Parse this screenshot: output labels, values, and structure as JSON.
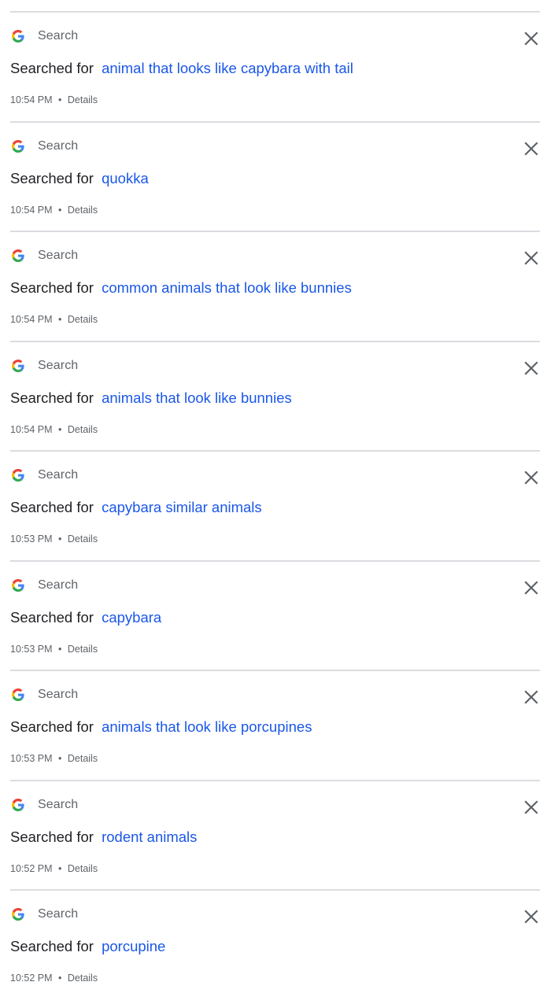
{
  "activity": {
    "items": [
      {
        "product": "Search",
        "prefix": "Searched for",
        "query": "animal that looks like capybara with tail",
        "time": "10:54 PM",
        "separator": "•",
        "details": "Details"
      },
      {
        "product": "Search",
        "prefix": "Searched for",
        "query": "quokka",
        "time": "10:54 PM",
        "separator": "•",
        "details": "Details"
      },
      {
        "product": "Search",
        "prefix": "Searched for",
        "query": "common animals that look like bunnies",
        "time": "10:54 PM",
        "separator": "•",
        "details": "Details"
      },
      {
        "product": "Search",
        "prefix": "Searched for",
        "query": "animals that look like bunnies",
        "time": "10:54 PM",
        "separator": "•",
        "details": "Details"
      },
      {
        "product": "Search",
        "prefix": "Searched for",
        "query": "capybara similar animals",
        "time": "10:53 PM",
        "separator": "•",
        "details": "Details"
      },
      {
        "product": "Search",
        "prefix": "Searched for",
        "query": "capybara",
        "time": "10:53 PM",
        "separator": "•",
        "details": "Details"
      },
      {
        "product": "Search",
        "prefix": "Searched for",
        "query": "animals that look like porcupines",
        "time": "10:53 PM",
        "separator": "•",
        "details": "Details"
      },
      {
        "product": "Search",
        "prefix": "Searched for",
        "query": "rodent animals",
        "time": "10:52 PM",
        "separator": "•",
        "details": "Details"
      },
      {
        "product": "Search",
        "prefix": "Searched for",
        "query": "porcupine",
        "time": "10:52 PM",
        "separator": "•",
        "details": "Details"
      }
    ]
  },
  "icons": {
    "product_icon": "google-g-icon",
    "delete_icon": "close-icon"
  },
  "colors": {
    "query_link": "#1a57e8",
    "text": "#202124",
    "secondary_text": "#5f6368",
    "divider": "#dadce0",
    "google_blue": "#4285f4",
    "google_red": "#ea4335",
    "google_yellow": "#fbbc05",
    "google_green": "#34a853"
  }
}
